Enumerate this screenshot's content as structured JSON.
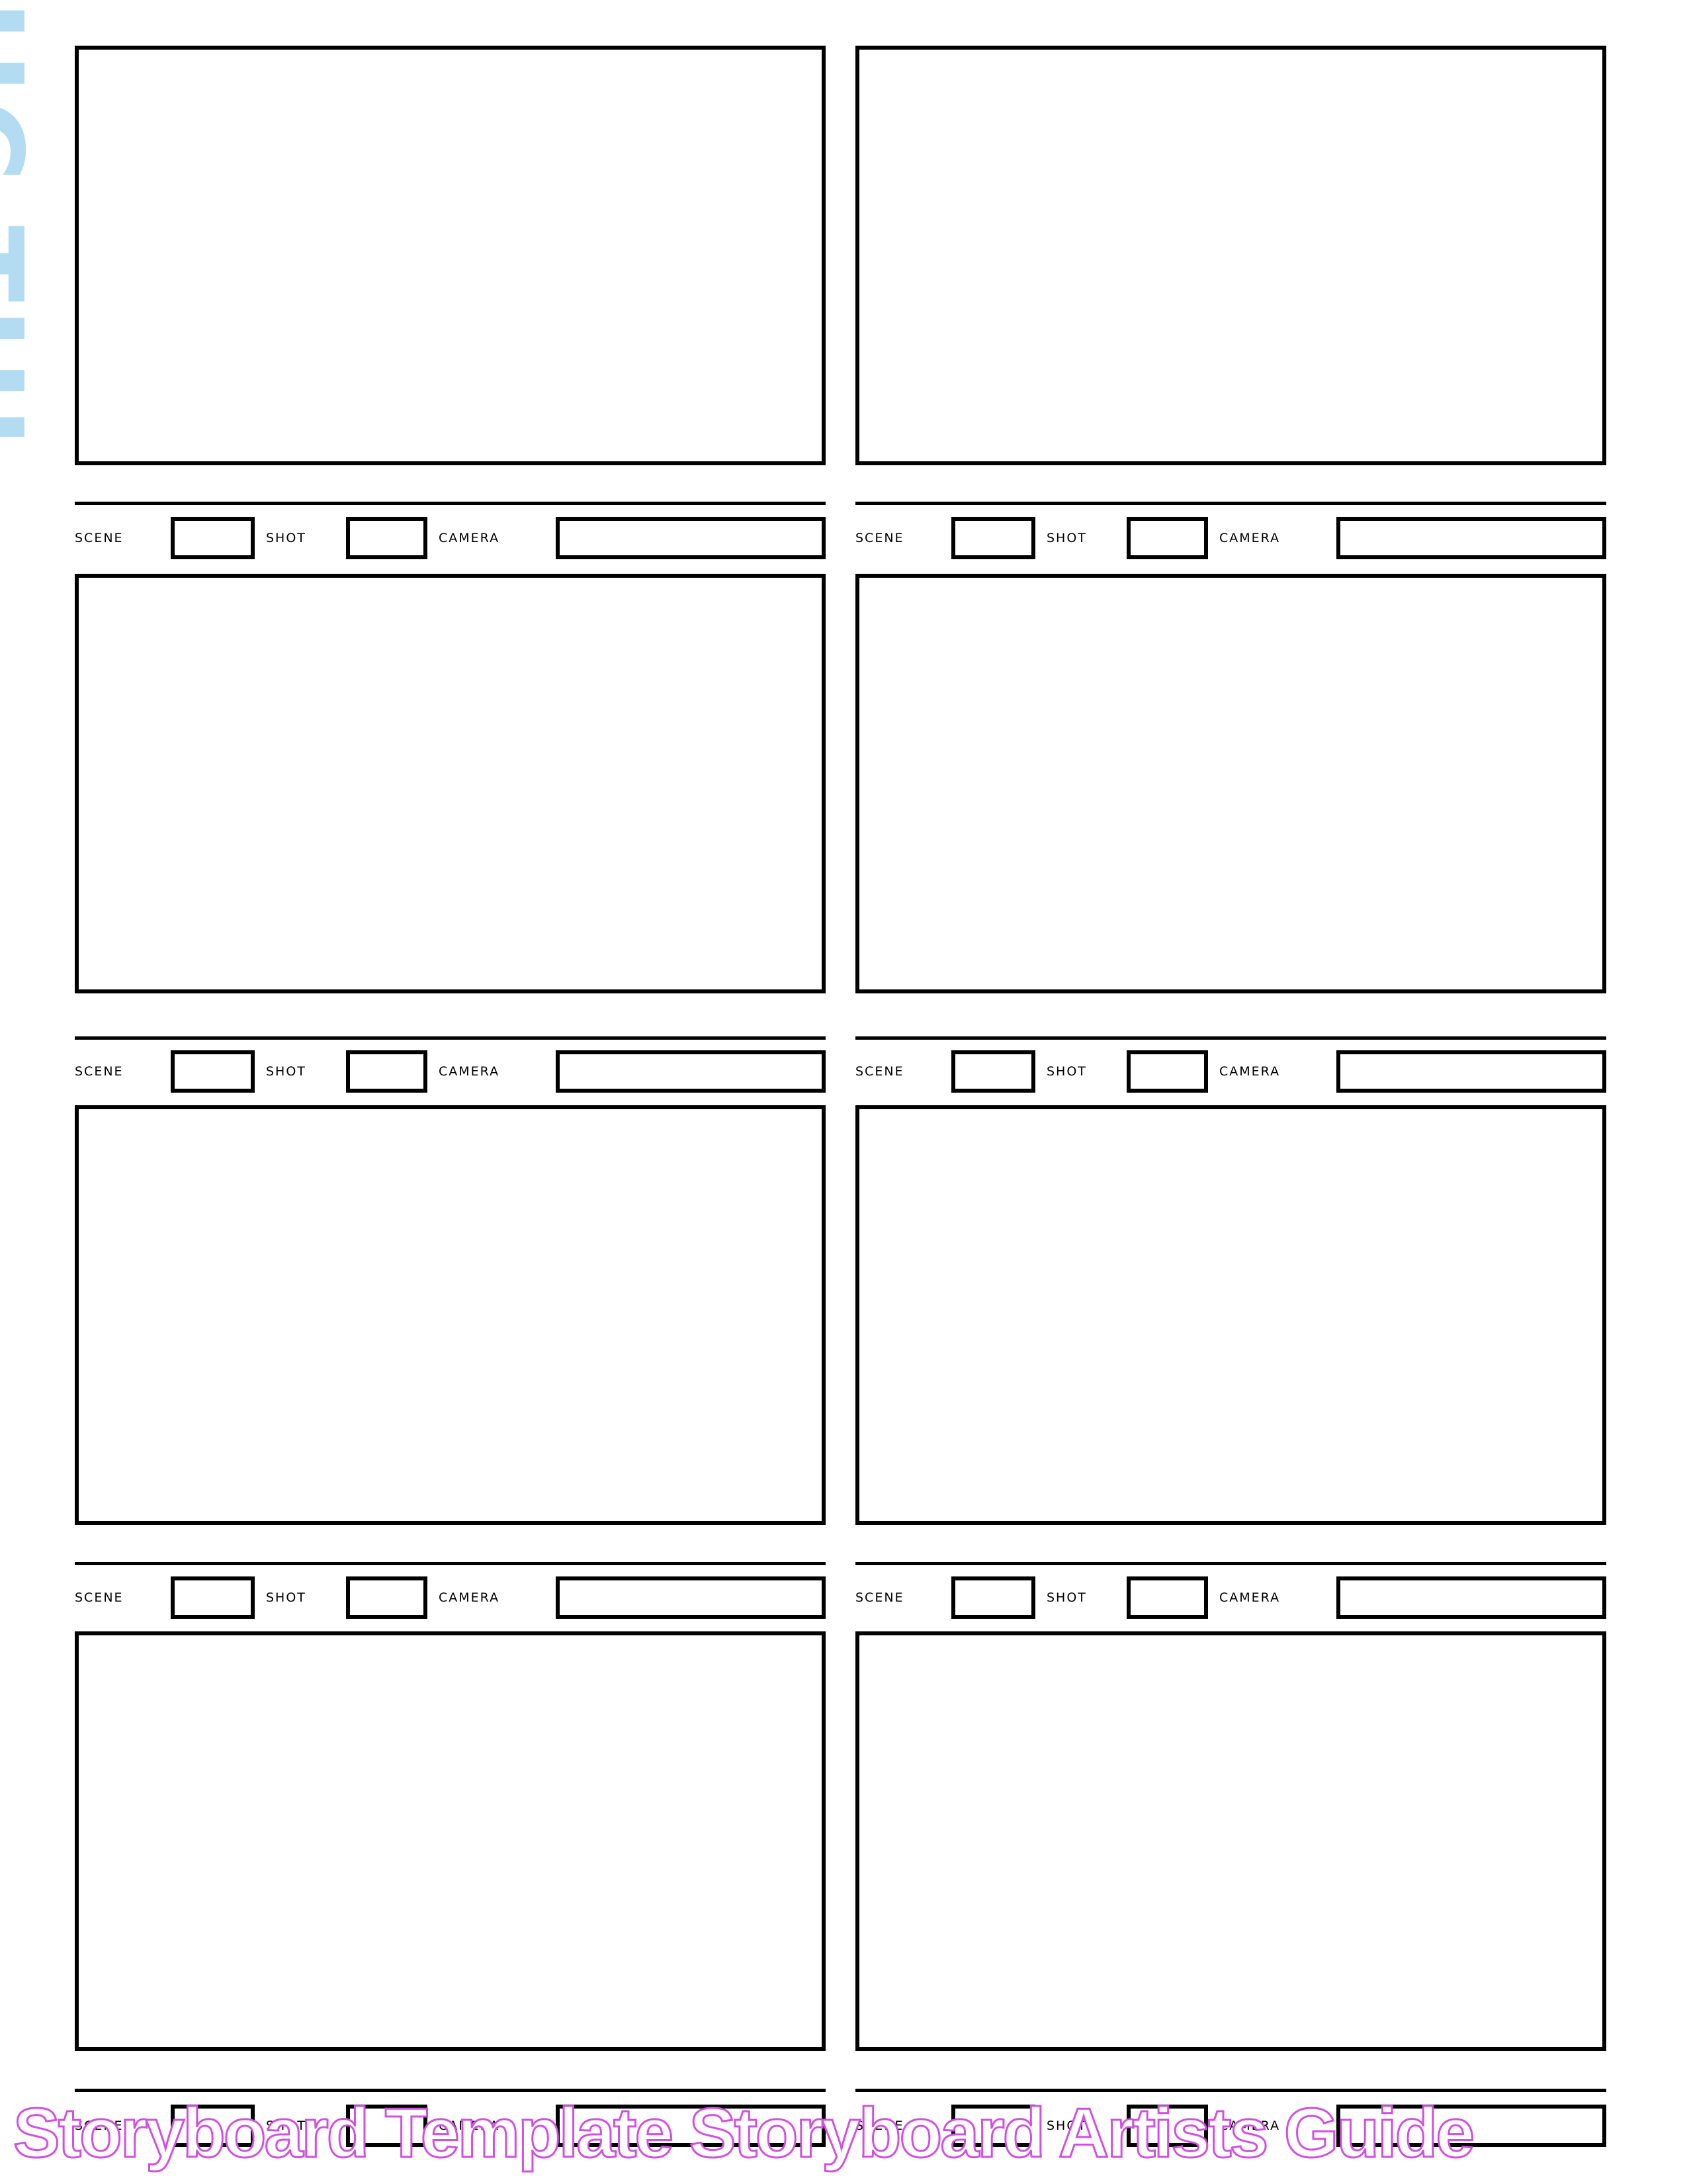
{
  "document": {
    "type": "storyboard-template",
    "columns": 2,
    "rows": 4
  },
  "side_logo": {
    "text": "HC-THD",
    "color": "#b3dcf2"
  },
  "labels": {
    "scene": "SCENE",
    "shot": "SHOT",
    "camera": "CAMERA"
  },
  "panels": [
    {
      "row": 1,
      "column": "left",
      "scene": "",
      "shot": "",
      "camera": ""
    },
    {
      "row": 1,
      "column": "right",
      "scene": "",
      "shot": "",
      "camera": ""
    },
    {
      "row": 2,
      "column": "left",
      "scene": "",
      "shot": "",
      "camera": ""
    },
    {
      "row": 2,
      "column": "right",
      "scene": "",
      "shot": "",
      "camera": ""
    },
    {
      "row": 3,
      "column": "left",
      "scene": "",
      "shot": "",
      "camera": ""
    },
    {
      "row": 3,
      "column": "right",
      "scene": "",
      "shot": "",
      "camera": ""
    },
    {
      "row": 4,
      "column": "left",
      "scene": "",
      "shot": "",
      "camera": ""
    },
    {
      "row": 4,
      "column": "right",
      "scene": "",
      "shot": "",
      "camera": ""
    }
  ],
  "watermark": {
    "text": "Storyboard Template Storyboard Artists Guide",
    "outline_color": "#d050e0"
  },
  "colors": {
    "ink": "#000000",
    "paper": "#ffffff"
  }
}
